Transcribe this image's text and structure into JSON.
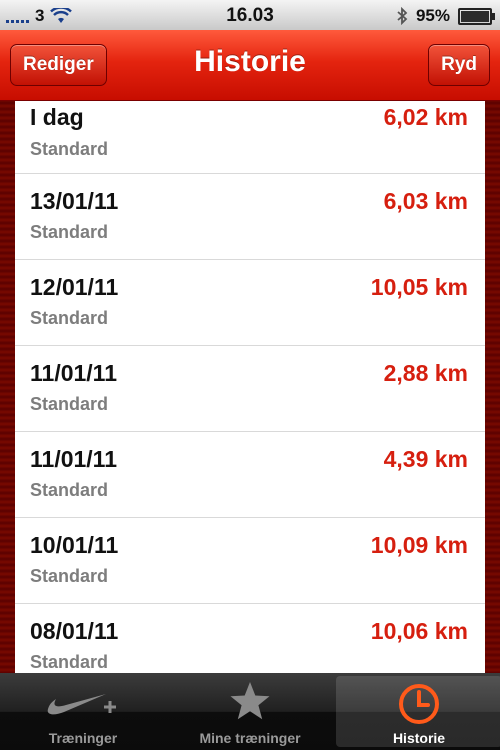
{
  "status": {
    "carrier": "3",
    "time": "16.03",
    "battery_pct": "95%"
  },
  "nav": {
    "title": "Historie",
    "edit_label": "Rediger",
    "clear_label": "Ryd"
  },
  "runs": [
    {
      "date": "I dag",
      "type": "Standard",
      "distance": "6,02 km"
    },
    {
      "date": "13/01/11",
      "type": "Standard",
      "distance": "6,03 km"
    },
    {
      "date": "12/01/11",
      "type": "Standard",
      "distance": "10,05 km"
    },
    {
      "date": "11/01/11",
      "type": "Standard",
      "distance": "2,88 km"
    },
    {
      "date": "11/01/11",
      "type": "Standard",
      "distance": "4,39 km"
    },
    {
      "date": "10/01/11",
      "type": "Standard",
      "distance": "10,09 km"
    },
    {
      "date": "08/01/11",
      "type": "Standard",
      "distance": "10,06 km"
    }
  ],
  "tabs": [
    {
      "label": "Træninger",
      "icon": "nike-swoosh-plus-icon"
    },
    {
      "label": "Mine træninger",
      "icon": "star-icon"
    },
    {
      "label": "Historie",
      "icon": "clock-icon"
    }
  ],
  "colors": {
    "accent": "#d61f0f",
    "nav_red": "#e4240f",
    "active_icon": "#ff5a1a"
  }
}
